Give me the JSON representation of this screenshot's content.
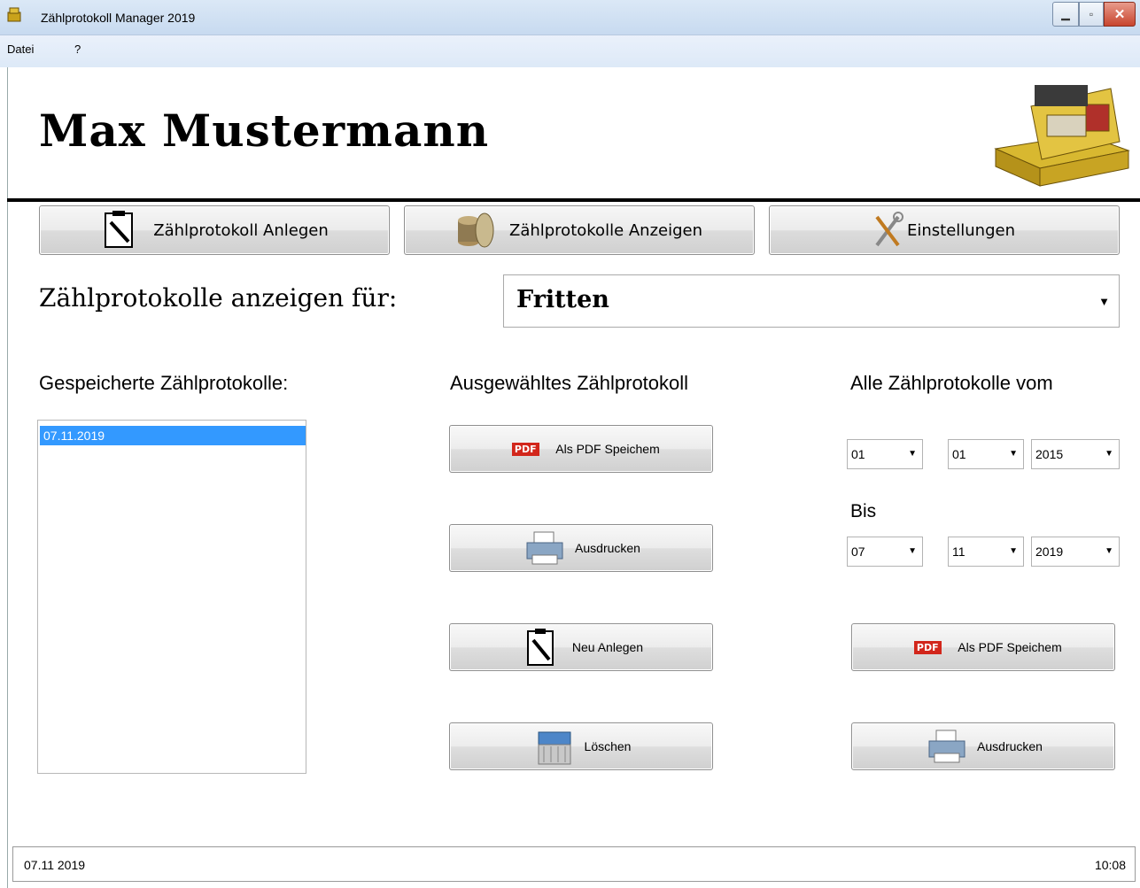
{
  "window": {
    "title": "Zählprotokoll Manager 2019",
    "minimize": "▭",
    "maximize": "▢",
    "close": "✕"
  },
  "menu": {
    "datei": "Datei",
    "help": "?"
  },
  "header": {
    "user_name": "Max Mustermann"
  },
  "toolbar": {
    "anlegen": "Zählprotokoll Anlegen",
    "anzeigen": "Zählprotokolle Anzeigen",
    "einstellungen": "Einstellungen"
  },
  "filter": {
    "label": "Zählprotokolle anzeigen für:",
    "selected": "Fritten"
  },
  "saved": {
    "heading": "Gespeicherte Zählprotokolle:",
    "items": [
      "07.11.2019"
    ]
  },
  "selected_protocol": {
    "heading": "Ausgewähltes Zählprotokoll",
    "save_pdf": "Als PDF Speichem",
    "print": "Ausdrucken",
    "new": "Neu Anlegen",
    "delete": "Löschen"
  },
  "all_protocols": {
    "heading": "Alle Zählprotokolle vom",
    "from": {
      "day": "01",
      "month": "01",
      "year": "2015"
    },
    "bis_label": "Bis",
    "to": {
      "day": "07",
      "month": "11",
      "year": "2019"
    },
    "save_pdf": "Als PDF Speichem",
    "print": "Ausdrucken"
  },
  "status": {
    "date": "07.11 2019",
    "time": "10:08"
  },
  "colors": {
    "selection": "#3399ff",
    "pdf_red": "#d2261b"
  },
  "icons": {
    "app": "cash-register-icon",
    "anlegen": "clipboard-pen-icon",
    "anzeigen": "coins-icon",
    "einstellungen": "tools-icon",
    "pdf": "pdf-icon",
    "print": "printer-icon",
    "delete": "shredder-icon"
  }
}
